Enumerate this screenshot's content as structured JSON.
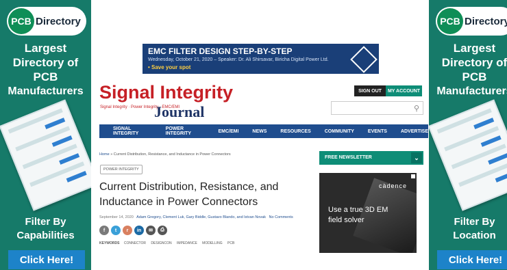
{
  "side_ad": {
    "logo_abbr": "PCB",
    "logo_word": "Directory",
    "heading_line1": "Largest",
    "heading_line2": "Directory of",
    "heading_line3": "PCB",
    "heading_line4": "Manufacturers",
    "left_filter_line1": "Filter By",
    "left_filter_line2": "Capabilities",
    "right_filter_line1": "Filter By",
    "right_filter_line2": "Location",
    "cta": "Click Here!"
  },
  "banner": {
    "title": "EMC FILTER DESIGN STEP-BY-STEP",
    "subtitle": "Wednesday, October 21, 2020  – Speaker: Dr. Ali Shirsavar, Biricha Digital Power Ltd.",
    "cta": "• Save your spot"
  },
  "logo": {
    "main": "Signal Integrity",
    "sub": "Signal Integrity · Power Integrity · EMC/EMI",
    "journal": "Journal"
  },
  "header": {
    "sign_out": "SIGN OUT",
    "my_account": "MY ACCOUNT"
  },
  "nav": [
    "SIGNAL INTEGRITY",
    "POWER INTEGRITY",
    "EMC/EMI",
    "NEWS",
    "RESOURCES",
    "COMMUNITY",
    "EVENTS",
    "ADVERTISE"
  ],
  "article": {
    "breadcrumb_home": "Home",
    "breadcrumb_rest": " » Current Distribution, Resistance, and Inductance in Power Connectors",
    "tag": "POWER INTEGRITY",
    "title": "Current Distribution, Resistance, and Inductance in Power Connectors",
    "date": "September 14, 2020",
    "authors": "Adam Gregory, Clement Luk, Gary Biddle, Gustavo Blando, and Istvan Novak",
    "comments": "No Comments",
    "keywords_label": "KEYWORDS",
    "keywords": [
      "CONNECTOR",
      "DESIGNCON",
      "IMPEDANCE",
      "MODELLING",
      "PCB"
    ]
  },
  "sidebar": {
    "newsletter": "FREE NEWSLETTER",
    "cadence_brand": "càdence",
    "cadence_line1": "Use a true 3D EM",
    "cadence_line2": "field solver"
  },
  "colors": {
    "teal": "#1f8a7a",
    "nav_blue": "#1f4d8e",
    "logo_red": "#c62026",
    "accent_green": "#0e8d77"
  }
}
